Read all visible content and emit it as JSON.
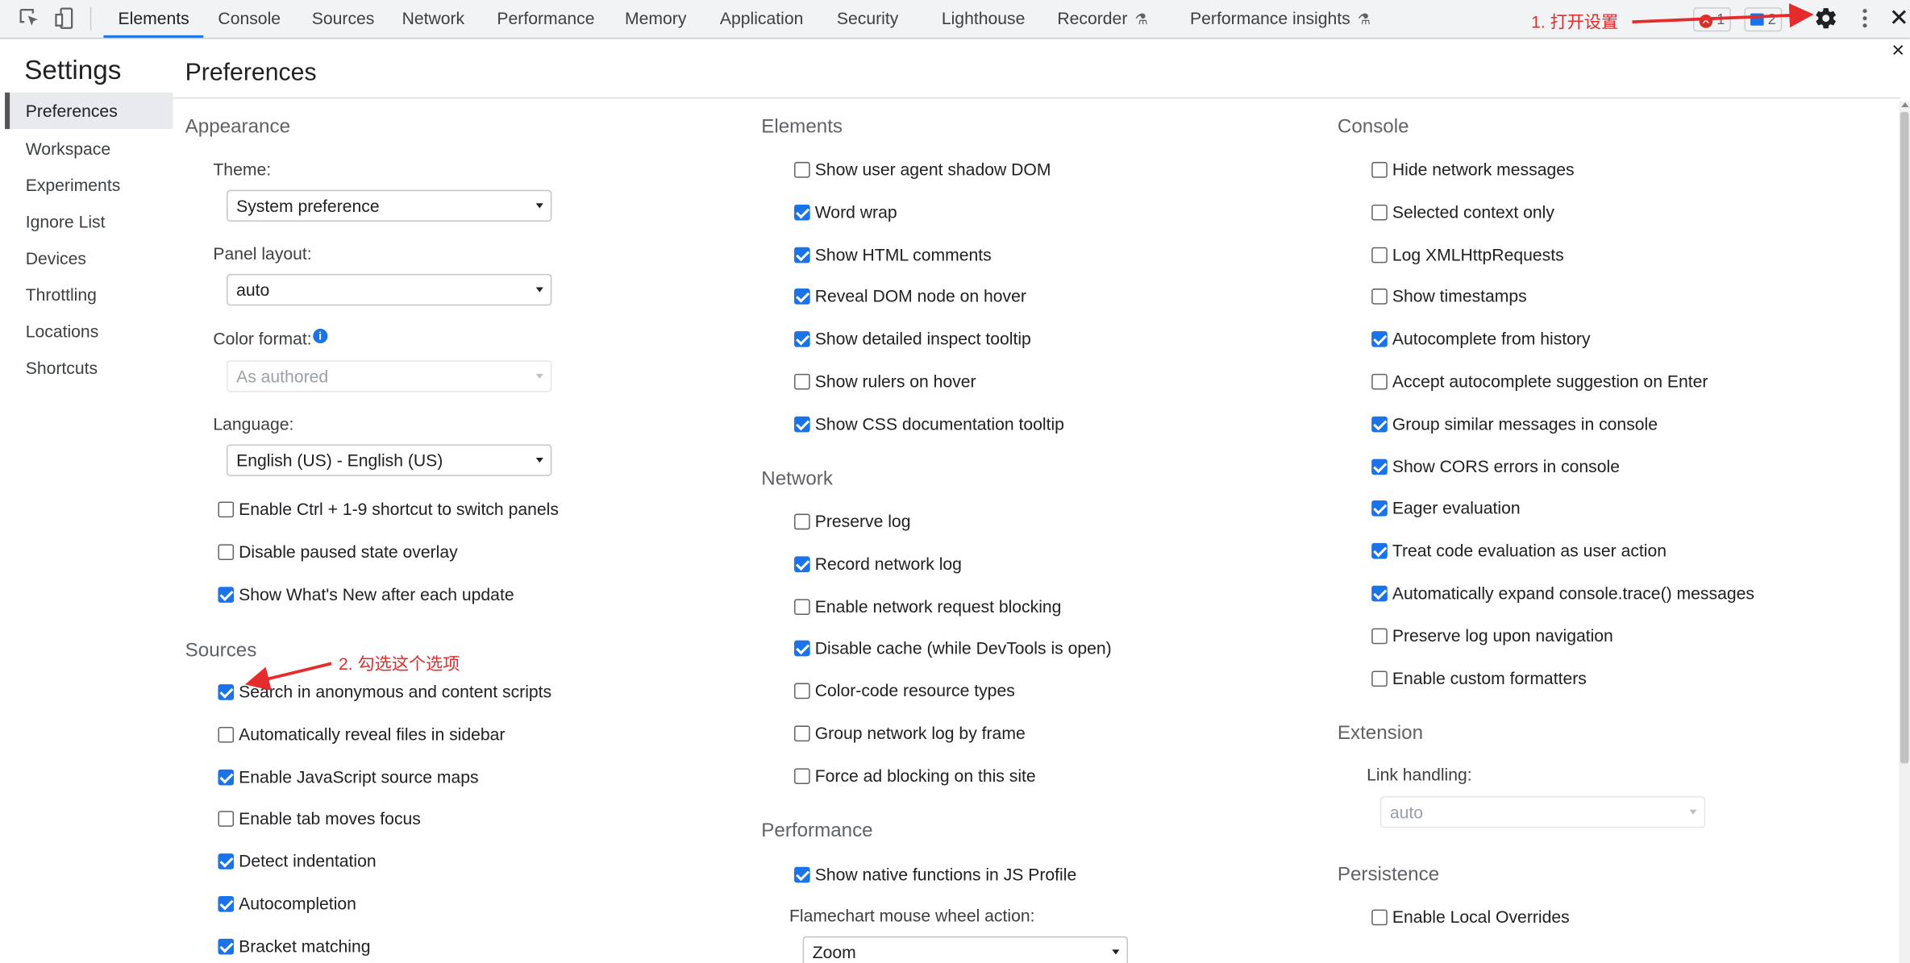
{
  "toolbar": {
    "tabs": [
      "Elements",
      "Console",
      "Sources",
      "Network",
      "Performance",
      "Memory",
      "Application",
      "Security",
      "Lighthouse",
      "Recorder",
      "Performance insights"
    ],
    "error_count": "1",
    "message_count": "2"
  },
  "annotations": {
    "step1": "1. 打开设置",
    "step2": "2. 勾选这个选项"
  },
  "sidebar": {
    "title": "Settings",
    "items": [
      "Preferences",
      "Workspace",
      "Experiments",
      "Ignore List",
      "Devices",
      "Throttling",
      "Locations",
      "Shortcuts"
    ]
  },
  "main": {
    "title": "Preferences",
    "appearance": {
      "heading": "Appearance",
      "theme_label": "Theme:",
      "theme_value": "System preference",
      "panel_layout_label": "Panel layout:",
      "panel_layout_value": "auto",
      "color_format_label": "Color format:",
      "color_format_value": "As authored",
      "language_label": "Language:",
      "language_value": "English (US) - English (US)",
      "checks": [
        {
          "label": "Enable Ctrl + 1-9 shortcut to switch panels",
          "checked": false
        },
        {
          "label": "Disable paused state overlay",
          "checked": false
        },
        {
          "label": "Show What's New after each update",
          "checked": true
        }
      ]
    },
    "sources": {
      "heading": "Sources",
      "checks": [
        {
          "label": "Search in anonymous and content scripts",
          "checked": true
        },
        {
          "label": "Automatically reveal files in sidebar",
          "checked": false
        },
        {
          "label": "Enable JavaScript source maps",
          "checked": true
        },
        {
          "label": "Enable tab moves focus",
          "checked": false
        },
        {
          "label": "Detect indentation",
          "checked": true
        },
        {
          "label": "Autocompletion",
          "checked": true
        },
        {
          "label": "Bracket matching",
          "checked": true
        }
      ]
    },
    "elements": {
      "heading": "Elements",
      "checks": [
        {
          "label": "Show user agent shadow DOM",
          "checked": false
        },
        {
          "label": "Word wrap",
          "checked": true
        },
        {
          "label": "Show HTML comments",
          "checked": true
        },
        {
          "label": "Reveal DOM node on hover",
          "checked": true
        },
        {
          "label": "Show detailed inspect tooltip",
          "checked": true
        },
        {
          "label": "Show rulers on hover",
          "checked": false
        },
        {
          "label": "Show CSS documentation tooltip",
          "checked": true
        }
      ]
    },
    "network": {
      "heading": "Network",
      "checks": [
        {
          "label": "Preserve log",
          "checked": false
        },
        {
          "label": "Record network log",
          "checked": true
        },
        {
          "label": "Enable network request blocking",
          "checked": false
        },
        {
          "label": "Disable cache (while DevTools is open)",
          "checked": true
        },
        {
          "label": "Color-code resource types",
          "checked": false
        },
        {
          "label": "Group network log by frame",
          "checked": false
        },
        {
          "label": "Force ad blocking on this site",
          "checked": false
        }
      ]
    },
    "performance": {
      "heading": "Performance",
      "checks": [
        {
          "label": "Show native functions in JS Profile",
          "checked": true
        }
      ],
      "flamechart_label": "Flamechart mouse wheel action:",
      "flamechart_value": "Zoom"
    },
    "console": {
      "heading": "Console",
      "checks": [
        {
          "label": "Hide network messages",
          "checked": false
        },
        {
          "label": "Selected context only",
          "checked": false
        },
        {
          "label": "Log XMLHttpRequests",
          "checked": false
        },
        {
          "label": "Show timestamps",
          "checked": false
        },
        {
          "label": "Autocomplete from history",
          "checked": true
        },
        {
          "label": "Accept autocomplete suggestion on Enter",
          "checked": false
        },
        {
          "label": "Group similar messages in console",
          "checked": true
        },
        {
          "label": "Show CORS errors in console",
          "checked": true
        },
        {
          "label": "Eager evaluation",
          "checked": true
        },
        {
          "label": "Treat code evaluation as user action",
          "checked": true
        },
        {
          "label": "Automatically expand console.trace() messages",
          "checked": true
        },
        {
          "label": "Preserve log upon navigation",
          "checked": false
        },
        {
          "label": "Enable custom formatters",
          "checked": false
        }
      ]
    },
    "extension": {
      "heading": "Extension",
      "link_handling_label": "Link handling:",
      "link_handling_value": "auto"
    },
    "persistence": {
      "heading": "Persistence",
      "checks": [
        {
          "label": "Enable Local Overrides",
          "checked": false
        }
      ]
    }
  }
}
